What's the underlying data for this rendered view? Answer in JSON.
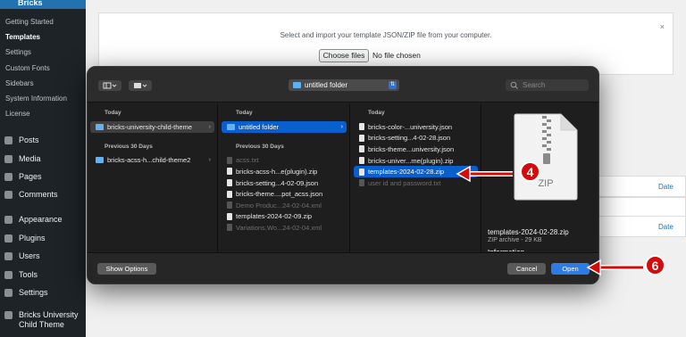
{
  "sidebar": {
    "brand": "Bricks",
    "subitems": [
      "Getting Started",
      "Templates",
      "Settings",
      "Custom Fonts",
      "Sidebars",
      "System Information",
      "License"
    ],
    "nav": [
      "Posts",
      "Media",
      "Pages",
      "Comments",
      "Appearance",
      "Plugins",
      "Users",
      "Tools",
      "Settings",
      "Bricks University Child Theme"
    ]
  },
  "upload": {
    "message": "Select and import your template JSON/ZIP file from your computer.",
    "close": "×",
    "choose_label": "Choose files",
    "no_file": "No file chosen"
  },
  "table_header": "Date",
  "dialog": {
    "location": "untitled folder",
    "search_placeholder": "Search",
    "col1": {
      "today": "Today",
      "today_items": [
        "bricks-university-child-theme"
      ],
      "prev": "Previous 30 Days",
      "prev_items": [
        "bricks-acss-h...child-theme2"
      ]
    },
    "col2": {
      "today": "Today",
      "today_items": [
        "untitled folder"
      ],
      "prev": "Previous 30 Days",
      "prev_items": [
        "acss.txt",
        "bricks-acss-h...e(plugin).zip",
        "bricks-setting...4-02-09.json",
        "bricks-theme....pot_acss.json",
        "Demo Produc...24-02-04.xml",
        "templates-2024-02-09.zip",
        "Variations.Wo...24-02-04.xml"
      ]
    },
    "col3": {
      "today": "Today",
      "items": [
        "bricks-color-...university.json",
        "bricks-setting...4-02-28.json",
        "bricks-theme...university.json",
        "bricks-univer...me(plugin).zip",
        "templates-2024-02-28.zip",
        "user id and password.txt"
      ]
    },
    "preview": {
      "zip_label": "ZIP",
      "filename": "templates-2024-02-28.zip",
      "meta": "ZIP archive - 29 KB",
      "info": "Information"
    },
    "show_options": "Show Options",
    "cancel": "Cancel",
    "open": "Open"
  },
  "markers": {
    "step4": "4",
    "step6": "6"
  }
}
